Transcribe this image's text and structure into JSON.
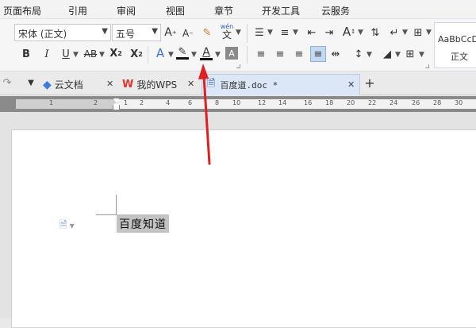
{
  "menu": [
    "页面布局",
    "引用",
    "审阅",
    "视图",
    "章节",
    "开发工具",
    "云服务"
  ],
  "ribbon": {
    "font_name": "宋体 (正文)",
    "font_size": "五号",
    "styles_preview": "AaBbCcDd",
    "styles_label": "正文",
    "pinyin_top": "wén",
    "pinyin_bottom": "文"
  },
  "tabs": {
    "cloud_docs": "云文档",
    "my_wps": "我的WPS",
    "doc_name": "百度道.doc *",
    "add": "+"
  },
  "ruler": {
    "labels": [
      "1",
      "2",
      "1",
      "2",
      "4",
      "6",
      "8",
      "10",
      "12",
      "14",
      "16",
      "18",
      "20",
      "22",
      "24",
      "26",
      "28",
      "30"
    ]
  },
  "document": {
    "selected_text": "百度知道"
  },
  "colors": {
    "arrow": "#e02020",
    "font_color_underline": "#111111",
    "highlight_underline": "#111111"
  }
}
